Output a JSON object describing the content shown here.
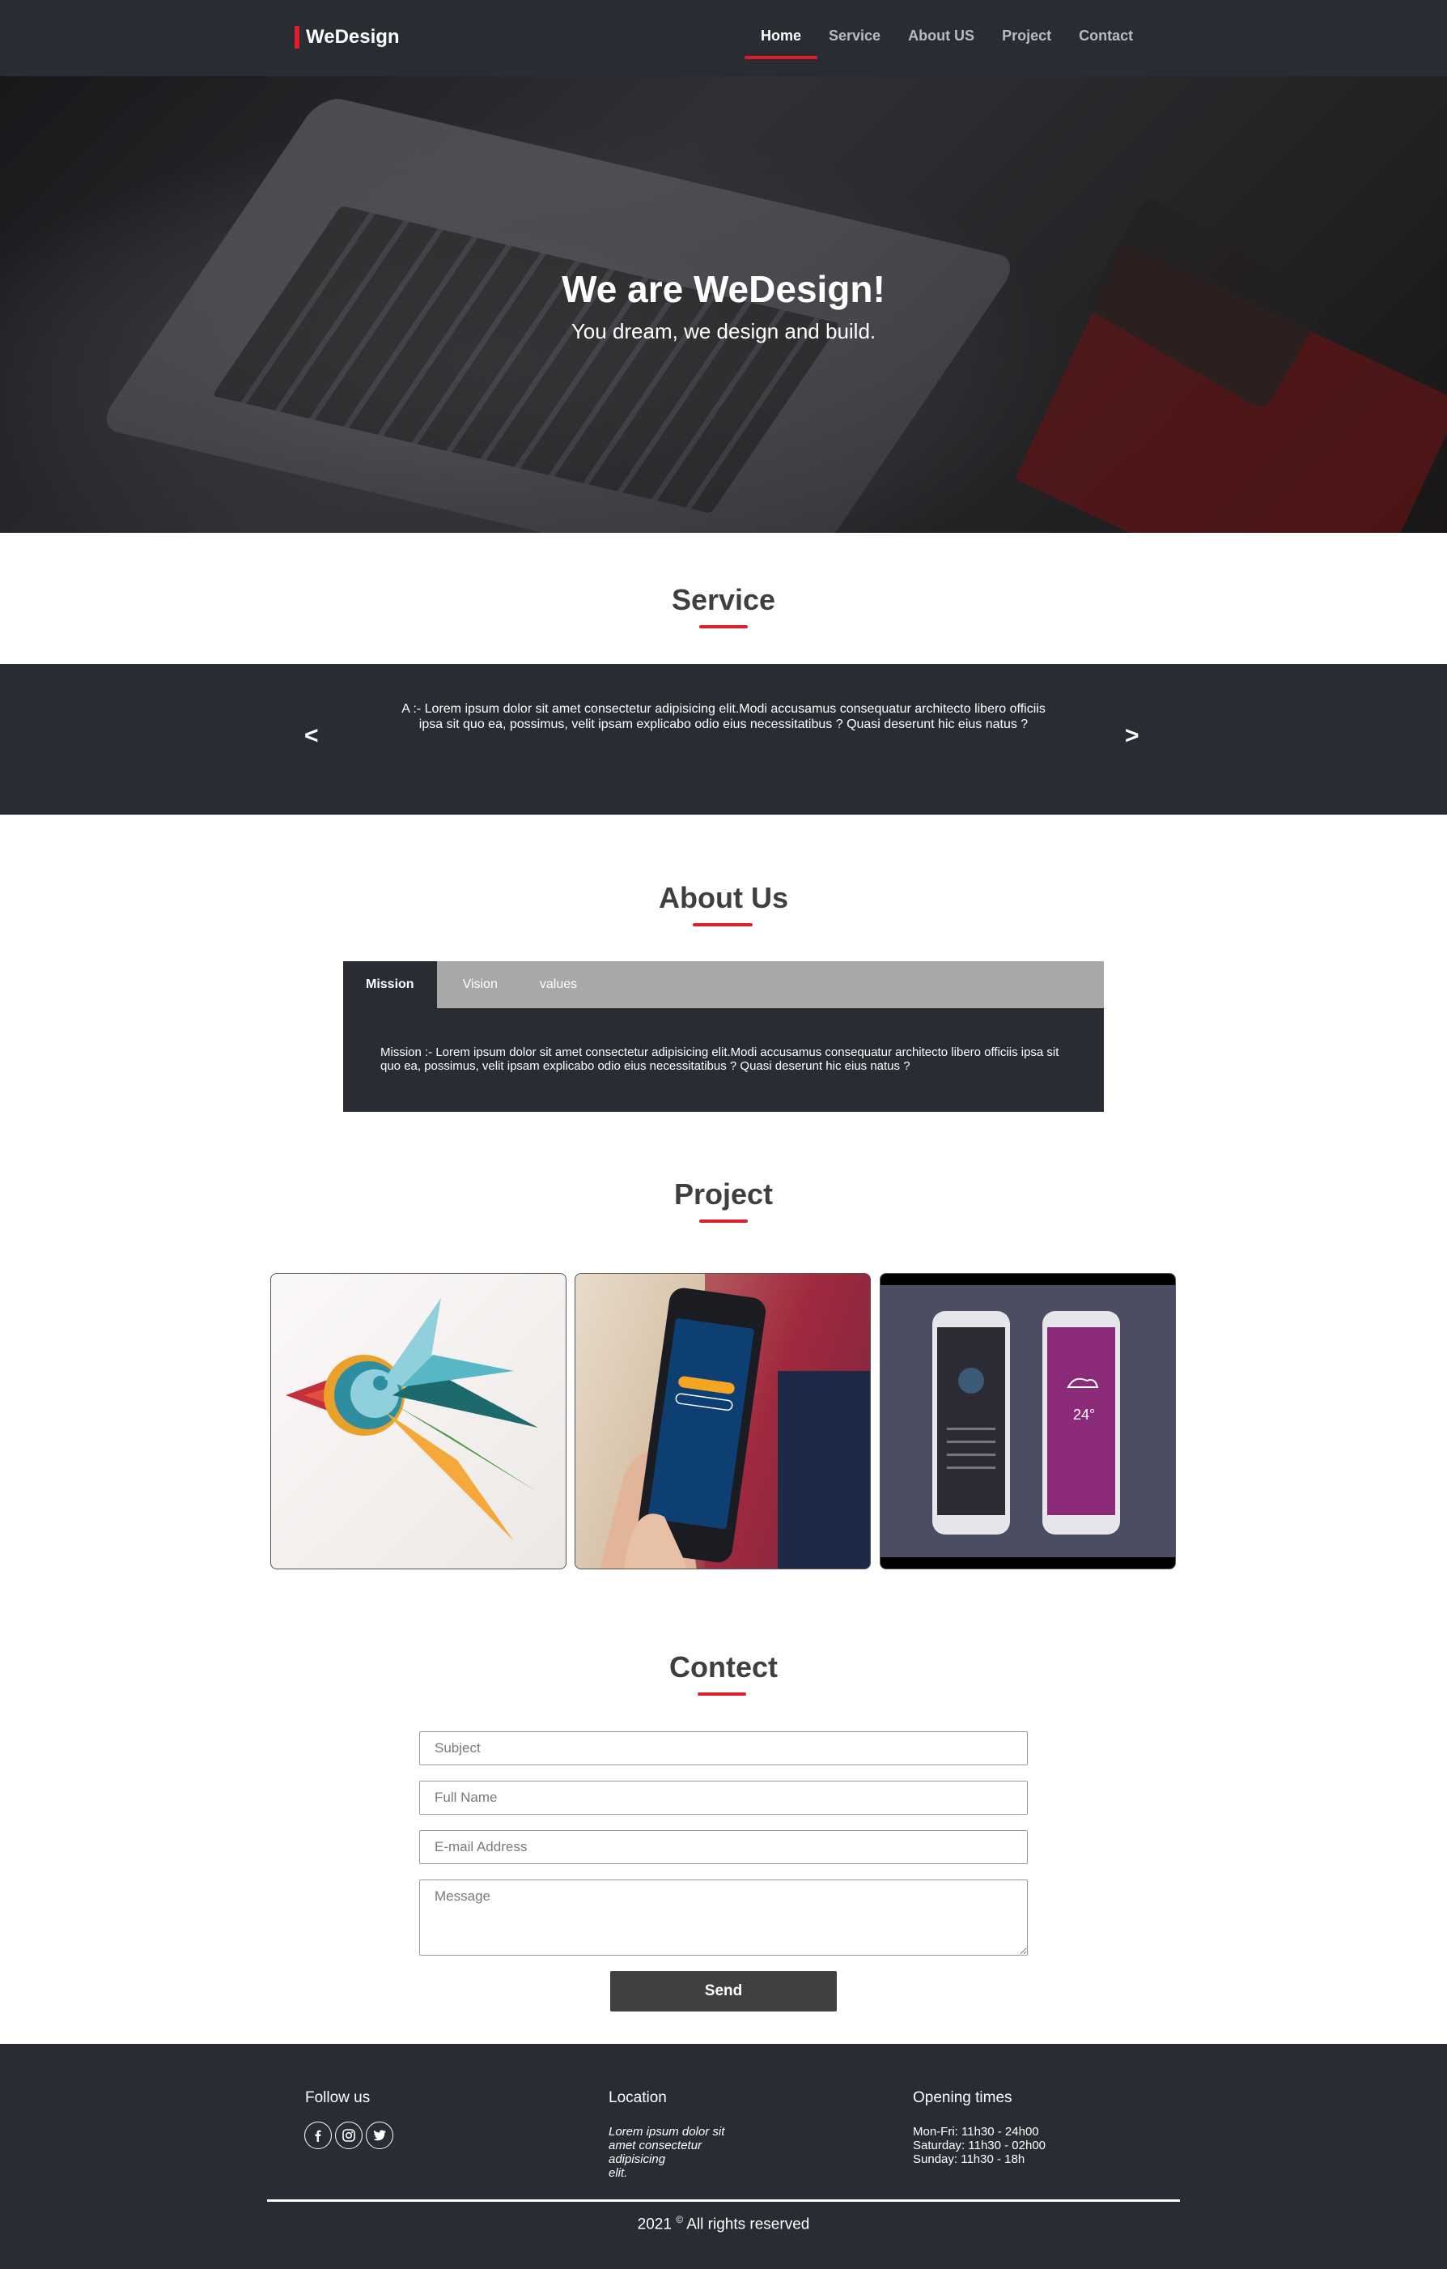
{
  "nav": {
    "logo": "WeDesign",
    "links": [
      "Home",
      "Service",
      "About US",
      "Project",
      "Contact"
    ],
    "active": "Home"
  },
  "hero": {
    "title": "We are WeDesign!",
    "subtitle": "You dream, we design and build."
  },
  "service": {
    "title": "Service",
    "prev": "<",
    "next": ">",
    "text": "A :- Lorem ipsum dolor sit amet consectetur adipisicing elit.Modi accusamus consequatur architecto libero officiis ipsa sit quo ea, possimus, velit ipsam explicabo odio eius necessitatibus ? Quasi deserunt hic eius natus ?"
  },
  "about": {
    "title": "About Us",
    "tabs": [
      "Mission",
      "Vision",
      "values"
    ],
    "active_tab": "Mission",
    "text": "Mission :- Lorem ipsum dolor sit amet consectetur adipisicing elit.Modi accusamus consequatur architecto libero officiis ipsa sit quo ea, possimus, velit ipsam explicabo odio eius necessitatibus ? Quasi deserunt hic eius natus ?"
  },
  "project": {
    "title": "Project",
    "images": [
      "bird-logo-image",
      "phone-in-hand-image",
      "two-phones-app-image"
    ]
  },
  "contact": {
    "title": "Contect",
    "subject_placeholder": "Subject",
    "name_placeholder": "Full Name",
    "email_placeholder": "E-mail Address",
    "message_placeholder": "Message",
    "send_label": "Send"
  },
  "footer": {
    "follow_title": "Follow us",
    "social": [
      "facebook-icon",
      "instagram-icon",
      "twitter-icon"
    ],
    "location_title": "Location",
    "location_lines": [
      "Lorem ipsum dolor sit",
      "amet consectetur",
      "adipisicing",
      "elit."
    ],
    "hours_title": "Opening times",
    "hours": [
      "Mon-Fri: 11h30 - 24h00",
      "Saturday: 11h30 - 02h00",
      "Sunday: 11h30 - 18h"
    ],
    "copyright_year": "2021",
    "copyright_symbol": "©",
    "copyright_text": "All rights reserved"
  },
  "colors": {
    "accent": "#e11d2b",
    "dark": "#2a2c34",
    "tab_bar": "#a8a8a8",
    "button": "#404042"
  }
}
